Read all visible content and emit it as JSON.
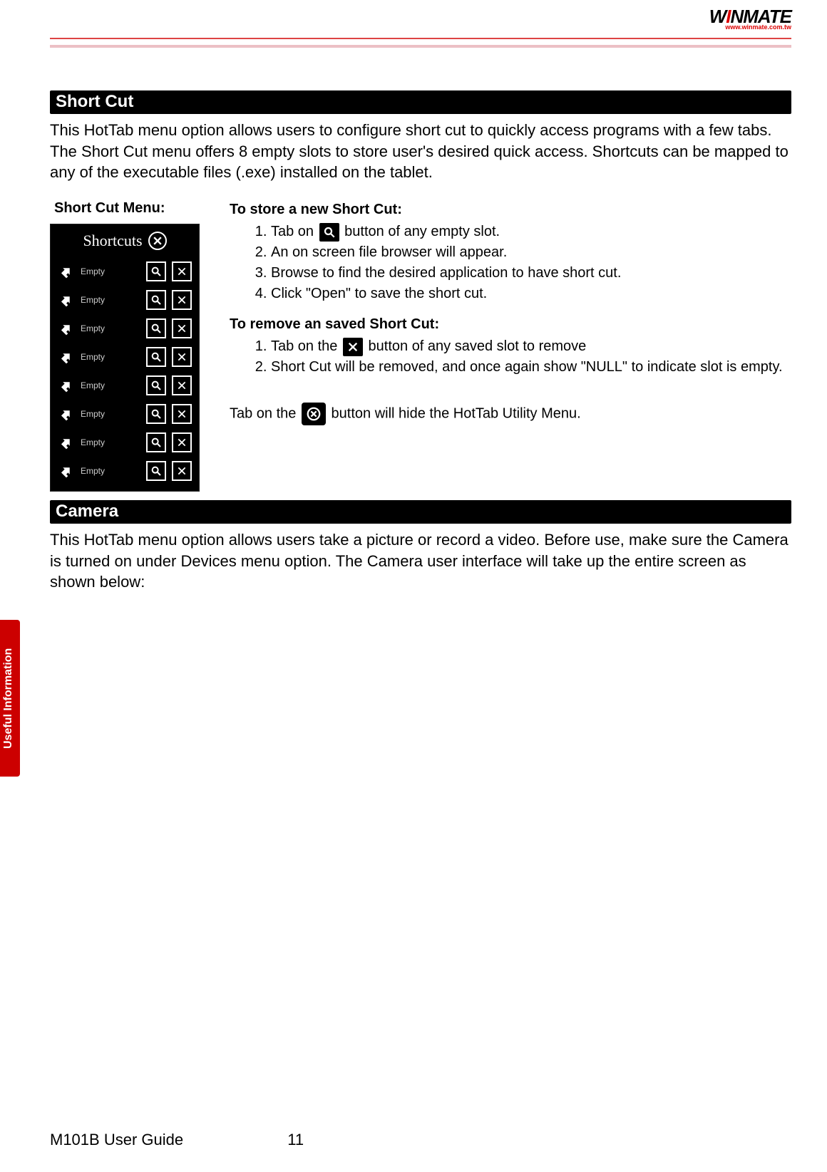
{
  "logo": {
    "text_prefix": "W",
    "text_i": "I",
    "text_rest": "NMATE",
    "sub": "www.winmate.com.tw"
  },
  "sideTab": {
    "active": "Useful Information"
  },
  "section1": {
    "title": "Short Cut",
    "intro": "This HotTab menu option allows users to configure short cut to quickly access programs with a few tabs. The Short Cut menu offers 8 empty slots to store user's desired quick access. Shortcuts can be mapped to any of the executable files (.exe) installed on the tablet.",
    "leftTitle": "Short Cut Menu:",
    "panel": {
      "header": "Shortcuts",
      "rowLabel": "Empty",
      "rows": 8
    },
    "storeTitle": "To store a new Short Cut:",
    "storeSteps": [
      {
        "pre": "Tab on ",
        "post": " button of any empty slot.",
        "icon": "search"
      },
      {
        "pre": "An on screen file browser will appear."
      },
      {
        "pre": "Browse to find the desired application to have short cut."
      },
      {
        "pre": "Click \"Open\" to save the short cut."
      }
    ],
    "removeTitle": "To remove an saved Short Cut:",
    "removeSteps": [
      {
        "pre": "Tab on the ",
        "post": " button of any saved slot to remove",
        "icon": "x"
      },
      {
        "pre": "Short Cut will be removed, and once again show \"NULL\" to indicate slot is empty."
      }
    ],
    "hideNote": {
      "pre": "Tab on the ",
      "post": " button will hide the HotTab Utility Menu."
    }
  },
  "section2": {
    "title": "Camera",
    "intro": "This HotTab menu option allows users take a picture or record a video. Before use, make sure the Camera is turned on under Devices menu option. The Camera user interface will take up the entire screen as shown below:"
  },
  "footer": {
    "doc": "M101B User Guide",
    "page": "11"
  }
}
